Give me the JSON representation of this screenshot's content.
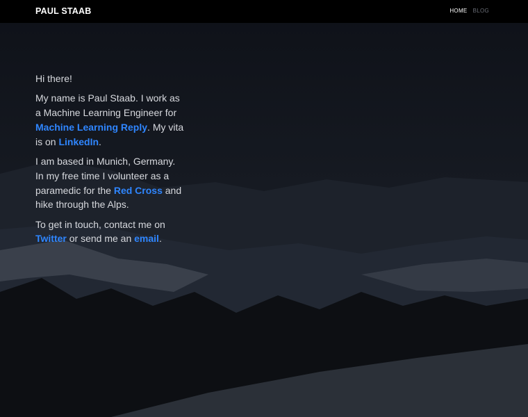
{
  "nav": {
    "brand": "PAUL STAAB",
    "links": [
      {
        "label": "HOME",
        "active": true
      },
      {
        "label": "BLOG",
        "active": false
      }
    ]
  },
  "intro": {
    "greeting": "Hi there!",
    "p1_a": "My name is Paul Staab. I work as a Machine Learning Engineer for ",
    "p1_link1": "Machine Learning Reply",
    "p1_b": ". My vita is on ",
    "p1_link2": "LinkedIn",
    "p1_c": ".",
    "p2_a": "I am based in Munich, Germany. In my free time I volunteer as a paramedic for the ",
    "p2_link": "Red Cross",
    "p2_b": " and hike through the Alps.",
    "p3_a": "To get in touch, contact me on ",
    "p3_link1": "Twitter",
    "p3_b": " or send me an ",
    "p3_link2": "email",
    "p3_c": "."
  },
  "colors": {
    "background": "#0b0d12",
    "link": "#2f86ff",
    "text": "#d7d9de",
    "navbar": "#000000"
  }
}
